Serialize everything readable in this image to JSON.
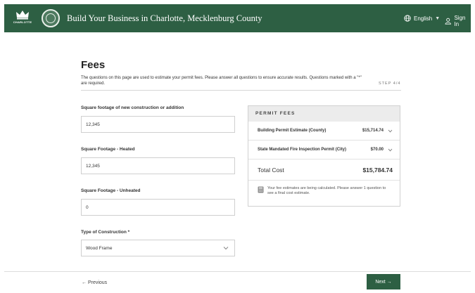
{
  "header": {
    "logo_text": "CHARLOTTE",
    "title": "Build Your Business in Charlotte, Mecklenburg County",
    "language": "English",
    "sign_in": "Sign In",
    "brand_color": "#2d5f43"
  },
  "page": {
    "title": "Fees",
    "intro": "The questions on this page are used to estimate your permit fees. Please answer all questions to ensure accurate results. Questions marked with a \"*\" are required.",
    "step": "STEP 4/4"
  },
  "form": {
    "fields": [
      {
        "label": "Square footage of new construction or addition",
        "value": "12,345"
      },
      {
        "label": "Square Footage - Heated",
        "value": "12,345"
      },
      {
        "label": "Square Footage - Unheated",
        "value": "0"
      },
      {
        "label": "Type of Construction *",
        "value": "Wood Frame"
      }
    ]
  },
  "fees": {
    "heading": "PERMIT FEES",
    "items": [
      {
        "name": "Building Permit Estimate (County)",
        "amount": "$15,714.74"
      },
      {
        "name": "State Mandated Fire Inspection Permit (City)",
        "amount": "$70.00"
      }
    ],
    "total_label": "Total Cost",
    "total_amount": "$15,784.74",
    "note": "Your fee estimates are being calculated. Please answer 1 question to see a final cost estimate."
  },
  "footer": {
    "previous": "← Previous",
    "next": "Next →"
  },
  "icons": {
    "crown": "crown-icon",
    "seal": "city-seal-icon",
    "globe": "globe-icon",
    "user": "user-icon",
    "chevron": "chevron-down-icon",
    "calculator": "calculator-icon"
  }
}
